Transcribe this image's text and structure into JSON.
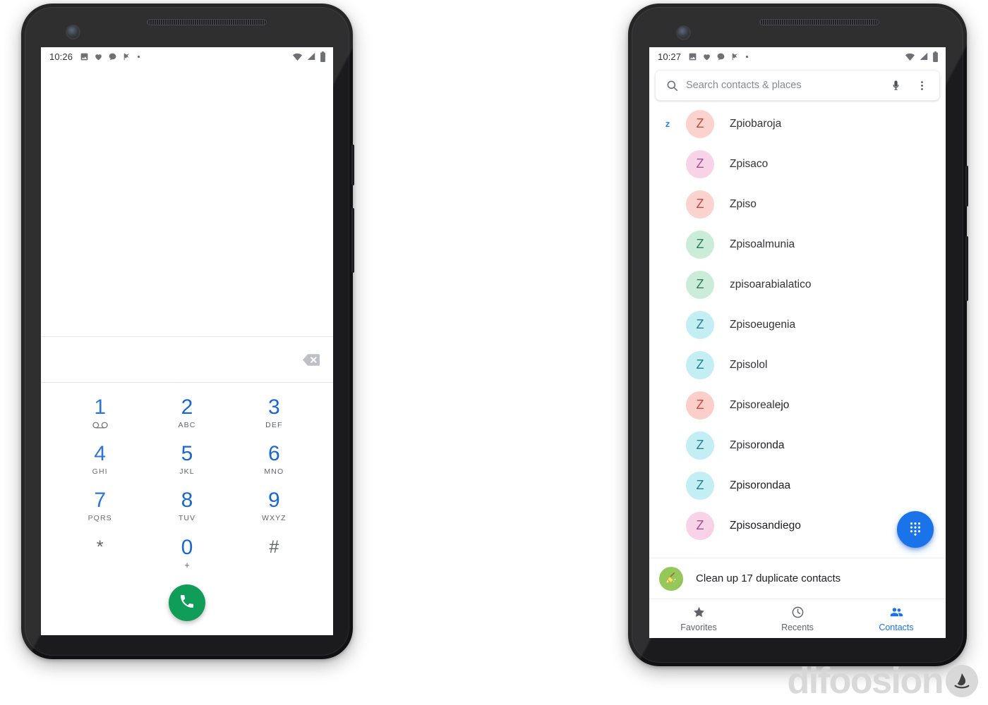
{
  "theme": {
    "dialer_blue": "#1967d2",
    "accent_blue": "#1a73e8",
    "call_green": "#0f9d58",
    "text_primary": "#202124",
    "text_secondary": "#5f6368"
  },
  "left_phone": {
    "statusbar": {
      "time": "10:26",
      "left_icons": [
        "photo-icon",
        "heart-icon",
        "chat-bubble-icon",
        "flag-icon",
        "dot-icon"
      ],
      "right_icons": [
        "wifi-icon",
        "signal-icon",
        "battery-icon"
      ]
    },
    "dialer": {
      "entered_number": "",
      "backspace_label": "backspace",
      "keys": [
        {
          "digit": "1",
          "sub": "",
          "icon": "voicemail-icon"
        },
        {
          "digit": "2",
          "sub": "ABC",
          "icon": ""
        },
        {
          "digit": "3",
          "sub": "DEF",
          "icon": ""
        },
        {
          "digit": "4",
          "sub": "GHI",
          "icon": ""
        },
        {
          "digit": "5",
          "sub": "JKL",
          "icon": ""
        },
        {
          "digit": "6",
          "sub": "MNO",
          "icon": ""
        },
        {
          "digit": "7",
          "sub": "PQRS",
          "icon": ""
        },
        {
          "digit": "8",
          "sub": "TUV",
          "icon": ""
        },
        {
          "digit": "9",
          "sub": "WXYZ",
          "icon": ""
        },
        {
          "digit": "*",
          "sub": "",
          "icon": ""
        },
        {
          "digit": "0",
          "sub": "+",
          "icon": ""
        },
        {
          "digit": "#",
          "sub": "",
          "icon": ""
        }
      ],
      "call_button_label": "Call"
    }
  },
  "right_phone": {
    "statusbar": {
      "time": "10:27",
      "left_icons": [
        "photo-icon",
        "heart-icon",
        "chat-bubble-icon",
        "flag-icon",
        "dot-icon"
      ],
      "right_icons": [
        "wifi-icon",
        "signal-icon",
        "battery-icon"
      ]
    },
    "search": {
      "placeholder": "Search contacts & places",
      "value": "",
      "search_icon": "search-icon",
      "voice_icon": "microphone-icon",
      "overflow_icon": "more-vertical-icon"
    },
    "section_letter": "z",
    "contacts": [
      {
        "name": "Zpiobaroja",
        "initial": "Z",
        "bg": "#f9cfcb",
        "fg": "#b5362f"
      },
      {
        "name": "Zpisaco",
        "initial": "Z",
        "bg": "#f8cfe5",
        "fg": "#9c3b84"
      },
      {
        "name": "Zpiso",
        "initial": "Z",
        "bg": "#f9cfcb",
        "fg": "#b5362f"
      },
      {
        "name": "Zpisoalmunia",
        "initial": "Z",
        "bg": "#c7ead6",
        "fg": "#1b6b45"
      },
      {
        "name": "zpisoarabialatico",
        "initial": "Z",
        "bg": "#c7ead6",
        "fg": "#1b6b45"
      },
      {
        "name": "Zpisoeugenia",
        "initial": "Z",
        "bg": "#bdecf3",
        "fg": "#11737f"
      },
      {
        "name": "Zpisolol",
        "initial": "Z",
        "bg": "#bdecf3",
        "fg": "#11737f"
      },
      {
        "name": "Zpisorealejo",
        "initial": "Z",
        "bg": "#fbc9c4",
        "fg": "#c0392b"
      },
      {
        "name": "Zpisoronda",
        "initial": "Z",
        "bg": "#bdecf3",
        "fg": "#11737f"
      },
      {
        "name": "Zpisorondaa",
        "initial": "Z",
        "bg": "#bdecf3",
        "fg": "#11737f"
      },
      {
        "name": "Zpisosandiego",
        "initial": "Z",
        "bg": "#f8cfe5",
        "fg": "#9c3b84"
      }
    ],
    "dial_fab": {
      "icon": "dialpad-icon",
      "label": "Open dialpad"
    },
    "cleanup": {
      "icon": "broom-icon",
      "text": "Clean up 17 duplicate contacts"
    },
    "bottom_nav": [
      {
        "label": "Favorites",
        "icon": "star-icon",
        "active": false
      },
      {
        "label": "Recents",
        "icon": "clock-icon",
        "active": false
      },
      {
        "label": "Contacts",
        "icon": "people-icon",
        "active": true
      }
    ]
  },
  "watermark": {
    "text": "difoosion",
    "logo": "difoosion-logo-icon"
  }
}
